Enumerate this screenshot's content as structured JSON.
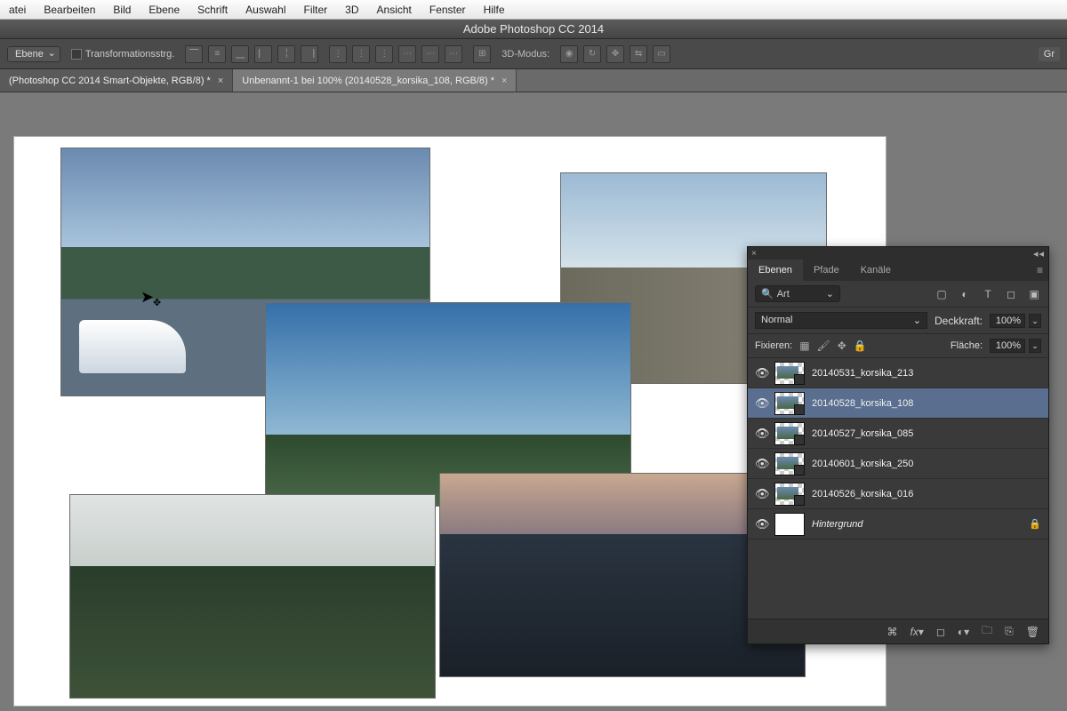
{
  "os_menu": [
    "atei",
    "Bearbeiten",
    "Bild",
    "Ebene",
    "Schrift",
    "Auswahl",
    "Filter",
    "3D",
    "Ansicht",
    "Fenster",
    "Hilfe"
  ],
  "app_title": "Adobe Photoshop CC 2014",
  "options": {
    "target_select": "Ebene",
    "transform_check": "Transformationsstrg.",
    "mode_3d_label": "3D-Modus:",
    "right_button": "Gr"
  },
  "tabs": [
    {
      "label": "(Photoshop CC 2014  Smart-Objekte, RGB/8) *",
      "active": false
    },
    {
      "label": "Unbenannt-1 bei 100% (20140528_korsika_108, RGB/8) *",
      "active": true
    }
  ],
  "panel": {
    "tabs": [
      "Ebenen",
      "Pfade",
      "Kanäle"
    ],
    "active_tab": 0,
    "search_label": "Art",
    "blend_mode": "Normal",
    "opacity_label": "Deckkraft:",
    "opacity_value": "100%",
    "lock_label": "Fixieren:",
    "fill_label": "Fläche:",
    "fill_value": "100%",
    "layers": [
      {
        "name": "20140531_korsika_213",
        "smart": true,
        "selected": false,
        "visible": true
      },
      {
        "name": "20140528_korsika_108",
        "smart": true,
        "selected": true,
        "visible": true
      },
      {
        "name": "20140527_korsika_085",
        "smart": true,
        "selected": false,
        "visible": true
      },
      {
        "name": "20140601_korsika_250",
        "smart": true,
        "selected": false,
        "visible": true
      },
      {
        "name": "20140526_korsika_016",
        "smart": true,
        "selected": false,
        "visible": true
      },
      {
        "name": "Hintergrund",
        "smart": false,
        "selected": false,
        "visible": true,
        "locked": true,
        "bg": true
      }
    ]
  }
}
